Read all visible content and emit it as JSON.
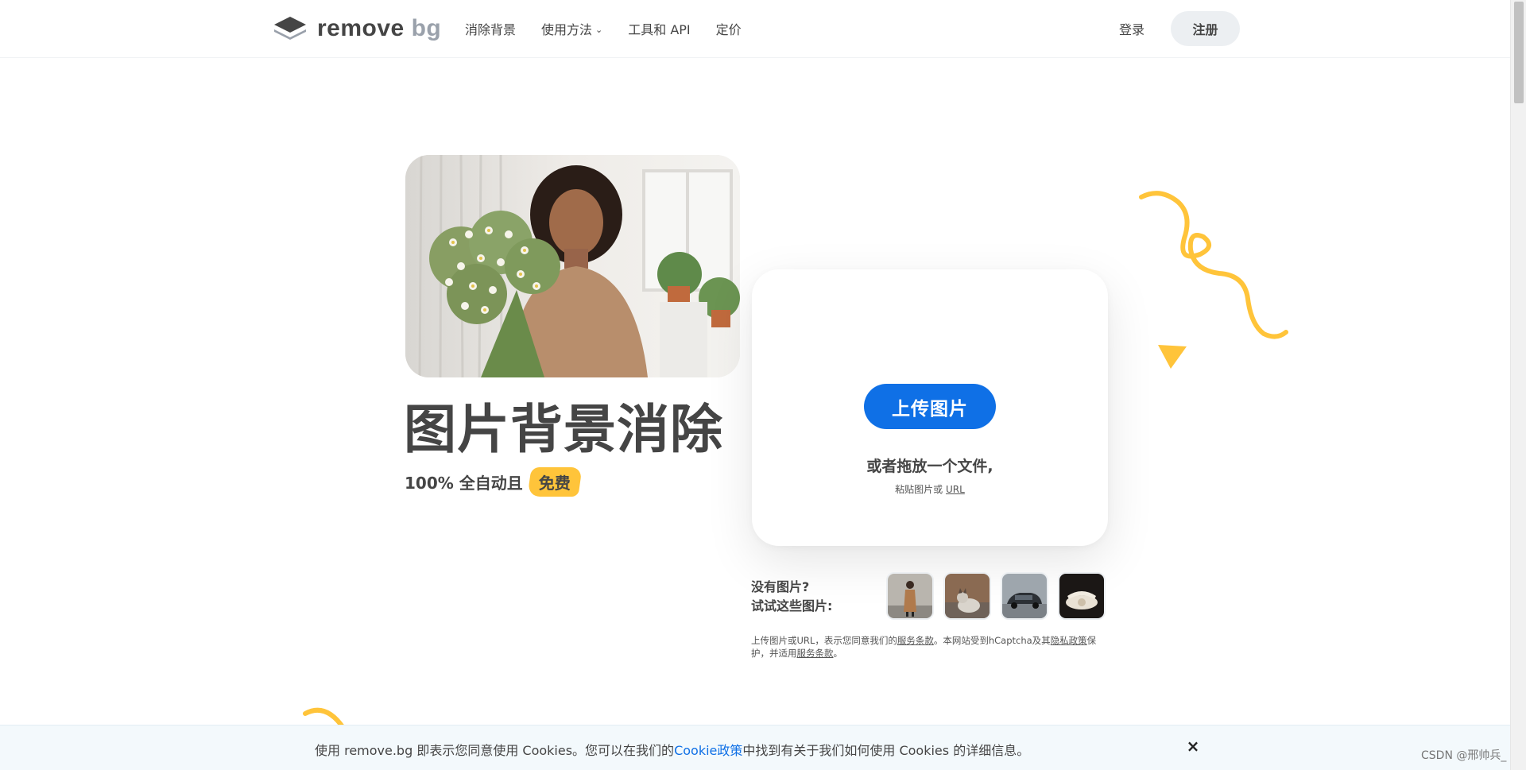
{
  "brand": {
    "name_main": "remove",
    "name_accent": "bg"
  },
  "nav": {
    "items": [
      {
        "label": "消除背景"
      },
      {
        "label": "使用方法"
      },
      {
        "label": "工具和 API"
      },
      {
        "label": "定价"
      }
    ],
    "login": "登录",
    "signup": "注册"
  },
  "hero": {
    "title": "图片背景消除",
    "subtitle": "100% 全自动且",
    "badge": "免费"
  },
  "upload": {
    "button": "上传图片",
    "drop_text": "或者拖放一个文件,",
    "paste_text": "粘贴图片或",
    "paste_url": "URL"
  },
  "samples": {
    "label_line1": "没有图片?",
    "label_line2": "试试这些图片:"
  },
  "terms": {
    "part1": "上传图片或URL，表示您同意我们的",
    "link1": "服务条款",
    "part2": "。本网站受到hCaptcha及其",
    "link2": "隐私政策",
    "part3": "保护，并适用",
    "link3": "服务条款",
    "part4": "。"
  },
  "cookie": {
    "text_before": "使用 remove.bg 即表示您同意使用 Cookies。您可以在我们的",
    "policy_link": "Cookie政策",
    "text_after": "中找到有关于我们如何使用 Cookies 的详细信息。",
    "close": "×"
  },
  "watermark": "CSDN @邢帅兵_",
  "colors": {
    "primary": "#0f70e6",
    "accent_yellow": "#ffc43a",
    "text": "#454545"
  }
}
